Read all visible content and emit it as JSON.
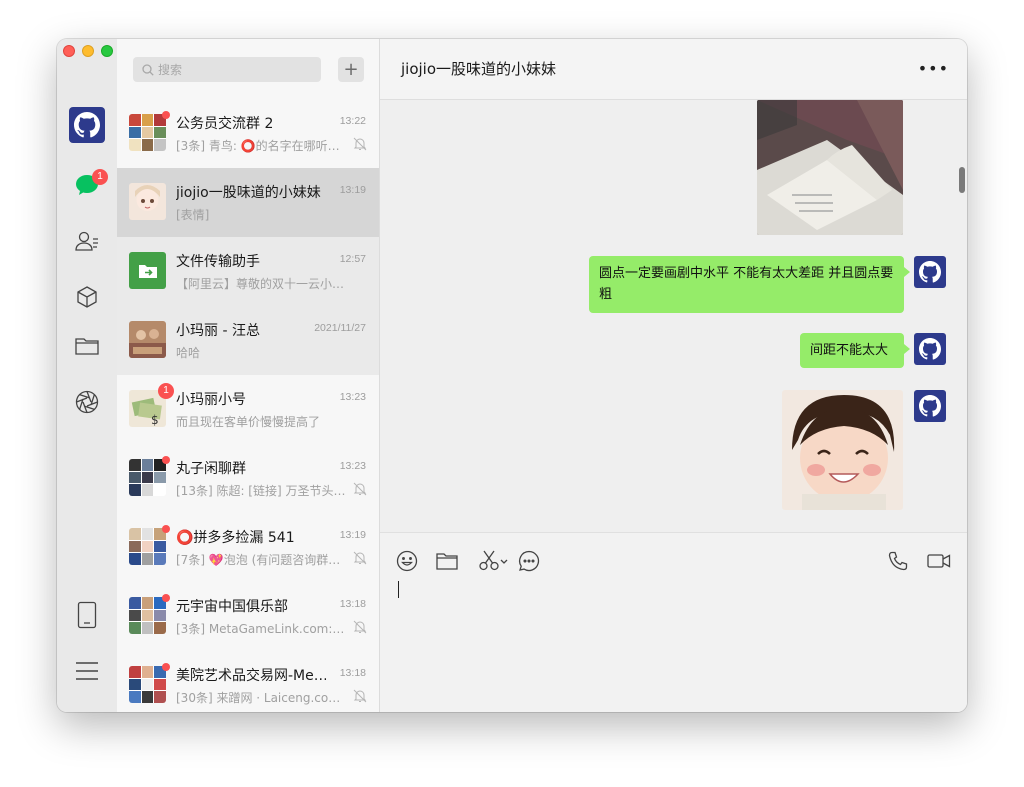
{
  "sidebar": {
    "chat_badge": "1",
    "icons": [
      "github-avatar",
      "chat-icon",
      "contacts-icon",
      "favorites-icon",
      "folder-icon",
      "moments-icon",
      "phone-icon",
      "menu-icon"
    ]
  },
  "search": {
    "placeholder": "搜索"
  },
  "conversations": [
    {
      "name": "公务员交流群 2",
      "time": "13:22",
      "preview": "[3条] 青鸟: ⭕的名字在哪听…",
      "muted": true
    },
    {
      "name": "jiojio一股味道的小妹妹",
      "time": "13:19",
      "preview": "[表情]",
      "muted": false
    },
    {
      "name": "文件传输助手",
      "time": "12:57",
      "preview": "【阿里云】尊敬的双十一云小宝…",
      "muted": false
    },
    {
      "name": "小玛丽 - 汪总",
      "time": "2021/11/27",
      "preview": "哈哈",
      "muted": false
    },
    {
      "name": "小玛丽小号",
      "time": "13:23",
      "preview": "而且现在客单价慢慢提高了",
      "muted": false,
      "badge": "1"
    },
    {
      "name": "丸子闲聊群",
      "time": "13:23",
      "preview": "[13条] 陈超: [链接] 万圣节头…",
      "muted": true
    },
    {
      "name": "⭕拼多多捡漏 541",
      "time": "13:19",
      "preview": "[7条] 💖泡泡 (有问题咨询群…",
      "muted": true
    },
    {
      "name": "元宇宙中国俱乐部",
      "time": "13:18",
      "preview": "[3条] MetaGameLink.com: nf…",
      "muted": true
    },
    {
      "name": "美院艺术品交易网-Me…",
      "time": "13:18",
      "preview": "[30条] 来蹭网 · Laiceng.com:…",
      "muted": true
    }
  ],
  "chat": {
    "title": "jiojio一股味道的小妹妹",
    "more": "•••",
    "messages": [
      {
        "type": "image",
        "desc": "book-photo"
      },
      {
        "type": "text",
        "text": "圆点一定要画剧中水平 不能有太大差距 并且圆点要粗"
      },
      {
        "type": "text",
        "text": "间距不能太大"
      },
      {
        "type": "image",
        "desc": "smiling-girl-sticker"
      }
    ]
  },
  "colors": {
    "accent": "#95ec69",
    "badge": "#fa5151",
    "avatar": "#2d3a8c"
  }
}
